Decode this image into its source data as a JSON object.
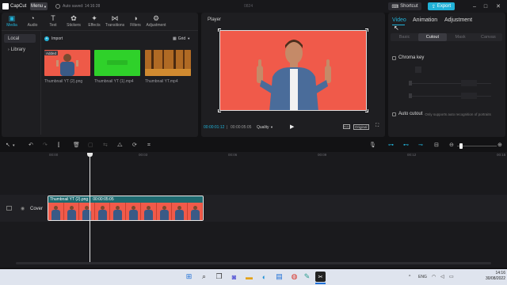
{
  "app": {
    "logo_text": "CapCut",
    "menu_label": "Menu",
    "autosave_text": "Auto saved: 14:16:28",
    "project_id": "0824",
    "shortcut_label": "Shortcut",
    "export_label": "Export"
  },
  "toolbar": {
    "items": [
      {
        "label": "Media",
        "icon": "media-icon",
        "glyph": "▣"
      },
      {
        "label": "Audio",
        "icon": "audio-icon",
        "glyph": "◔"
      },
      {
        "label": "Text",
        "icon": "text-icon",
        "glyph": "T"
      },
      {
        "label": "Stickers",
        "icon": "stickers-icon",
        "glyph": "✿"
      },
      {
        "label": "Effects",
        "icon": "effects-icon",
        "glyph": "✦"
      },
      {
        "label": "Transitions",
        "icon": "transitions-icon",
        "glyph": "⋈"
      },
      {
        "label": "Filters",
        "icon": "filters-icon",
        "glyph": "◑"
      },
      {
        "label": "Adjustment",
        "icon": "adjustment-icon",
        "glyph": "⚙"
      }
    ]
  },
  "media": {
    "sidebar": [
      "Local",
      "Library"
    ],
    "import_label": "Import",
    "view_label": "Grid",
    "added_badge": "Added",
    "items": [
      {
        "caption": "Thumbnail YT (2).png",
        "kind": "photo"
      },
      {
        "caption": "Thumbnail YT (1).mp4",
        "kind": "green"
      },
      {
        "caption": "Thumbnail YT.mp4",
        "kind": "forest"
      }
    ]
  },
  "player": {
    "title": "Player",
    "current_time": "00:00:01:12",
    "total_time": "00:00:05:05",
    "quality_label": "Quality",
    "ratio_label": "Ratio",
    "original_label": "Original"
  },
  "inspector": {
    "tabs": [
      "Video",
      "Animation",
      "Adjustment"
    ],
    "subtabs": [
      "Basic",
      "Cutout",
      "Mask",
      "Canvas"
    ],
    "chroma_key_label": "Chroma key",
    "auto_cutout_label": "Auto cutout",
    "auto_cutout_hint": "Only supports auto recognition of portraits"
  },
  "timeline": {
    "ruler_labels": [
      "00:00",
      "00:03",
      "00:06",
      "00:09",
      "00:12",
      "00:15"
    ],
    "clip_name": "Thumbnail YT (2).png",
    "clip_duration": "00:00:05:05",
    "cover_label": "Cover"
  },
  "taskbar": {
    "time": "14:16",
    "date": "30/08/2022",
    "lang": "ENG"
  },
  "colors": {
    "accent": "#21b2d8",
    "canvas_bg": "#f05a4a"
  }
}
